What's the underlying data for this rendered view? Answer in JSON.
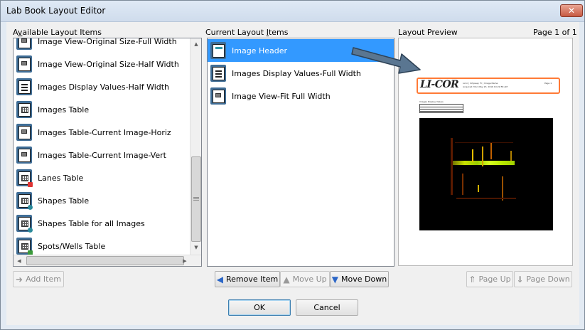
{
  "window": {
    "title": "Lab Book Layout Editor",
    "close_glyph": "✕"
  },
  "available": {
    "label_pre": "A",
    "label_u": "v",
    "label_post": "ailable Layout Items",
    "items": [
      {
        "label": "Image View-Original Size-Full Width",
        "icon": "image-view-icon"
      },
      {
        "label": "Image View-Original Size-Half Width",
        "icon": "image-view-icon"
      },
      {
        "label": "Images Display Values-Half Width",
        "icon": "display-values-icon"
      },
      {
        "label": "Images Table",
        "icon": "table-icon"
      },
      {
        "label": "Images Table-Current Image-Horiz",
        "icon": "image-table-icon"
      },
      {
        "label": "Images Table-Current Image-Vert",
        "icon": "image-table-icon"
      },
      {
        "label": "Lanes Table",
        "icon": "lanes-table-icon"
      },
      {
        "label": "Shapes Table",
        "icon": "shapes-table-icon"
      },
      {
        "label": "Shapes Table for all Images",
        "icon": "shapes-table-icon"
      },
      {
        "label": "Spots/Wells Table",
        "icon": "spots-table-icon"
      }
    ],
    "scroll_position": 0.72
  },
  "current": {
    "label_pre": "Current Layout ",
    "label_u": "I",
    "label_post": "tems",
    "items": [
      {
        "label": "Image Header",
        "icon": "image-header-icon",
        "selected": true
      },
      {
        "label": "Images Display Values-Full Width",
        "icon": "display-values-icon",
        "selected": false
      },
      {
        "label": "Image View-Fit Full Width",
        "icon": "image-view-icon",
        "selected": false
      }
    ]
  },
  "preview": {
    "label": "Layout Preview",
    "page_indicator": "Page 1 of 1",
    "logo_text": "LI-COR",
    "header_line1": "Licor | Odyssey Fc  |  Image Name",
    "header_line2": "Acquired: Mon May 23, 2016 10:22:58 AM",
    "page_num": "Page 1",
    "section_title": "Images Display Values"
  },
  "buttons": {
    "add_item": "Add Item",
    "remove_item": "Remove Item",
    "move_up": "Move Up",
    "move_down": "Move Down",
    "page_up": "Page Up",
    "page_down": "Page Down",
    "ok": "OK",
    "cancel": "Cancel"
  },
  "colors": {
    "selection": "#3399ff",
    "highlight": "#ff7a36",
    "arrow": "#5a7691"
  }
}
